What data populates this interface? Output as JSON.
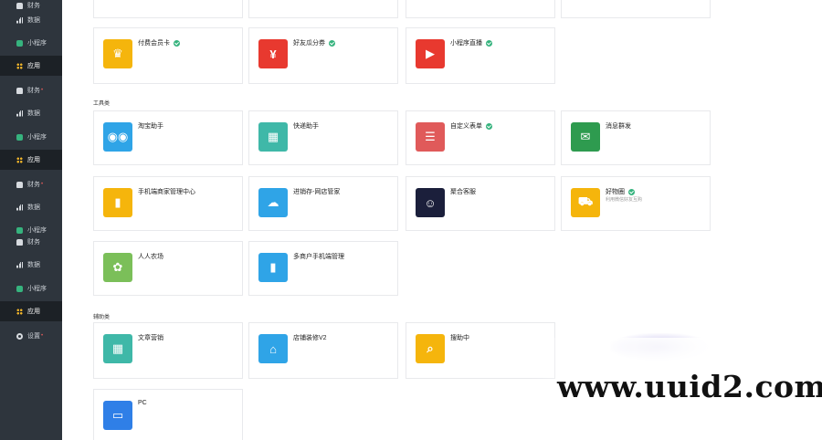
{
  "sidebar": {
    "items": [
      {
        "label": "财务",
        "icon": "bag-icon",
        "active": false,
        "dot": false
      },
      {
        "label": "数据",
        "icon": "bar-chart-icon",
        "active": false,
        "dot": false
      },
      {
        "label": "小程序",
        "icon": "mini-program-icon",
        "active": false,
        "dot": false
      },
      {
        "label": "应用",
        "icon": "grid-icon",
        "active": true,
        "dot": false
      },
      {
        "label": "财务",
        "icon": "bag-icon",
        "active": false,
        "dot": true
      },
      {
        "label": "数据",
        "icon": "bar-chart-icon",
        "active": false,
        "dot": false
      },
      {
        "label": "小程序",
        "icon": "mini-program-icon",
        "active": false,
        "dot": false
      },
      {
        "label": "应用",
        "icon": "grid-icon",
        "active": true,
        "dot": false
      },
      {
        "label": "财务",
        "icon": "bag-icon",
        "active": false,
        "dot": true
      },
      {
        "label": "数据",
        "icon": "bar-chart-icon",
        "active": false,
        "dot": false
      },
      {
        "label": "小程序",
        "icon": "mini-program-icon",
        "active": false,
        "dot": false
      },
      {
        "label": "财务",
        "icon": "bag-icon",
        "active": false,
        "dot": false
      },
      {
        "label": "数据",
        "icon": "bar-chart-icon",
        "active": false,
        "dot": false
      },
      {
        "label": "小程序",
        "icon": "mini-program-icon",
        "active": false,
        "dot": false
      },
      {
        "label": "应用",
        "icon": "grid-icon",
        "active": true,
        "dot": false
      },
      {
        "label": "设置",
        "icon": "gear-icon",
        "active": false,
        "dot": true
      }
    ],
    "dot_char": "•"
  },
  "sections": {
    "tools": "工具类",
    "help": "辅助类"
  },
  "cards": [
    {
      "title": "付费会员卡",
      "sub": "",
      "verified": true,
      "color": "#f5b50c",
      "glyph": "♛",
      "icon": "member-card-icon"
    },
    {
      "title": "好友瓜分券",
      "sub": "",
      "verified": true,
      "color": "#e8392f",
      "glyph": "¥",
      "icon": "red-envelope-icon"
    },
    {
      "title": "小程序直播",
      "sub": "",
      "verified": true,
      "color": "#e8392f",
      "glyph": "▶",
      "icon": "live-stream-icon"
    },
    {
      "title": "淘宝助手",
      "sub": "",
      "verified": false,
      "color": "#2fa4e7",
      "glyph": "◉◉",
      "icon": "taobao-helper-icon"
    },
    {
      "title": "快递助手",
      "sub": "",
      "verified": false,
      "color": "#3fb8a8",
      "glyph": "▦",
      "icon": "express-icon"
    },
    {
      "title": "自定义表单",
      "sub": "",
      "verified": true,
      "color": "#e05a5a",
      "glyph": "☰",
      "icon": "custom-form-icon"
    },
    {
      "title": "消息群发",
      "sub": "",
      "verified": false,
      "color": "#2e9b4f",
      "glyph": "✉",
      "icon": "message-icon"
    },
    {
      "title": "手机端商家管理中心",
      "sub": "",
      "verified": false,
      "color": "#f5b50c",
      "glyph": "▮",
      "icon": "mobile-merchant-icon"
    },
    {
      "title": "进销存-网店管家",
      "sub": "",
      "verified": false,
      "color": "#2fa4e7",
      "glyph": "☁",
      "icon": "inventory-icon"
    },
    {
      "title": "聚合客服",
      "sub": "",
      "verified": false,
      "color": "#1b1f3b",
      "glyph": "☺",
      "icon": "customer-service-icon"
    },
    {
      "title": "好物圈",
      "sub": "利用微信好友互购",
      "verified": true,
      "color": "#f5b50c",
      "glyph": "⛟",
      "icon": "good-items-icon"
    },
    {
      "title": "人人农场",
      "sub": "",
      "verified": false,
      "color": "#7bbf59",
      "glyph": "✿",
      "icon": "farm-icon"
    },
    {
      "title": "多商户手机端管理",
      "sub": "",
      "verified": false,
      "color": "#2fa4e7",
      "glyph": "▮",
      "icon": "multi-merchant-icon"
    },
    {
      "title": "文章营销",
      "sub": "",
      "verified": false,
      "color": "#3fb8a8",
      "glyph": "▦",
      "icon": "article-marketing-icon"
    },
    {
      "title": "店铺装修V2",
      "sub": "",
      "verified": false,
      "color": "#2fa4e7",
      "glyph": "⌂",
      "icon": "shop-decoration-icon"
    },
    {
      "title": "搜助中",
      "sub": "",
      "verified": false,
      "color": "#f5b50c",
      "glyph": "⌕",
      "icon": "search-helper-icon"
    },
    {
      "title": "PC",
      "sub": "",
      "verified": false,
      "color": "#2f7fe7",
      "glyph": "▭",
      "icon": "pc-icon"
    }
  ],
  "watermark": "www.uuid2.com"
}
